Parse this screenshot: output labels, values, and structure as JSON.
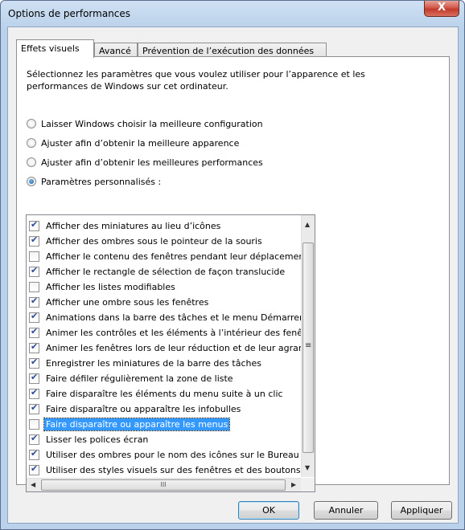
{
  "window": {
    "title": "Options de performances",
    "close_glyph": "X"
  },
  "tabs": [
    {
      "label": "Effets visuels",
      "active": true
    },
    {
      "label": "Avancé",
      "active": false
    },
    {
      "label": "Prévention de l’exécution des données",
      "active": false
    }
  ],
  "intro": "Sélectionnez les paramètres que vous voulez utiliser pour l’apparence et les performances de Windows sur cet ordinateur.",
  "radios": [
    {
      "label": "Laisser Windows choisir la meilleure configuration",
      "selected": false
    },
    {
      "label": "Ajuster afin d’obtenir la meilleure apparence",
      "selected": false
    },
    {
      "label": "Ajuster afin d’obtenir les meilleures performances",
      "selected": false
    },
    {
      "label": "Paramètres personnalisés :",
      "selected": true
    }
  ],
  "effects": [
    {
      "label": "Afficher des miniatures au lieu d’icônes",
      "checked": true
    },
    {
      "label": "Afficher des ombres sous le pointeur de la souris",
      "checked": true
    },
    {
      "label": "Afficher le contenu des fenêtres pendant leur déplacemen",
      "checked": false
    },
    {
      "label": "Afficher le rectangle de sélection de façon translucide",
      "checked": true
    },
    {
      "label": "Afficher les listes modifiables",
      "checked": false
    },
    {
      "label": "Afficher une ombre sous les fenêtres",
      "checked": true
    },
    {
      "label": "Animations dans la barre des tâches et le menu Démarrer",
      "checked": true
    },
    {
      "label": "Animer les contrôles et les éléments à l’intérieur des fenêtr",
      "checked": true
    },
    {
      "label": "Animer les fenêtres lors de leur réduction et de leur agrani",
      "checked": true
    },
    {
      "label": "Enregistrer les miniatures de la barre des tâches",
      "checked": true
    },
    {
      "label": "Faire défiler régulièrement la zone de liste",
      "checked": true
    },
    {
      "label": "Faire disparaître les éléments du menu suite à un clic",
      "checked": true
    },
    {
      "label": "Faire disparaître ou apparaître les infobulles",
      "checked": true
    },
    {
      "label": "Faire disparaître ou apparaître les menus",
      "checked": false,
      "selected": true
    },
    {
      "label": "Lisser les polices écran",
      "checked": true
    },
    {
      "label": "Utiliser des ombres pour le nom des icônes sur le Bureau",
      "checked": true
    },
    {
      "label": "Utiliser des styles visuels sur des fenêtres et des boutons",
      "checked": true
    }
  ],
  "scrollbar": {
    "up": "▲",
    "down": "▼",
    "left": "◀",
    "right": "▶",
    "grip": "≡",
    "hgrip": "III"
  },
  "buttons": {
    "ok": "OK",
    "cancel": "Annuler",
    "apply": "Appliquer"
  }
}
